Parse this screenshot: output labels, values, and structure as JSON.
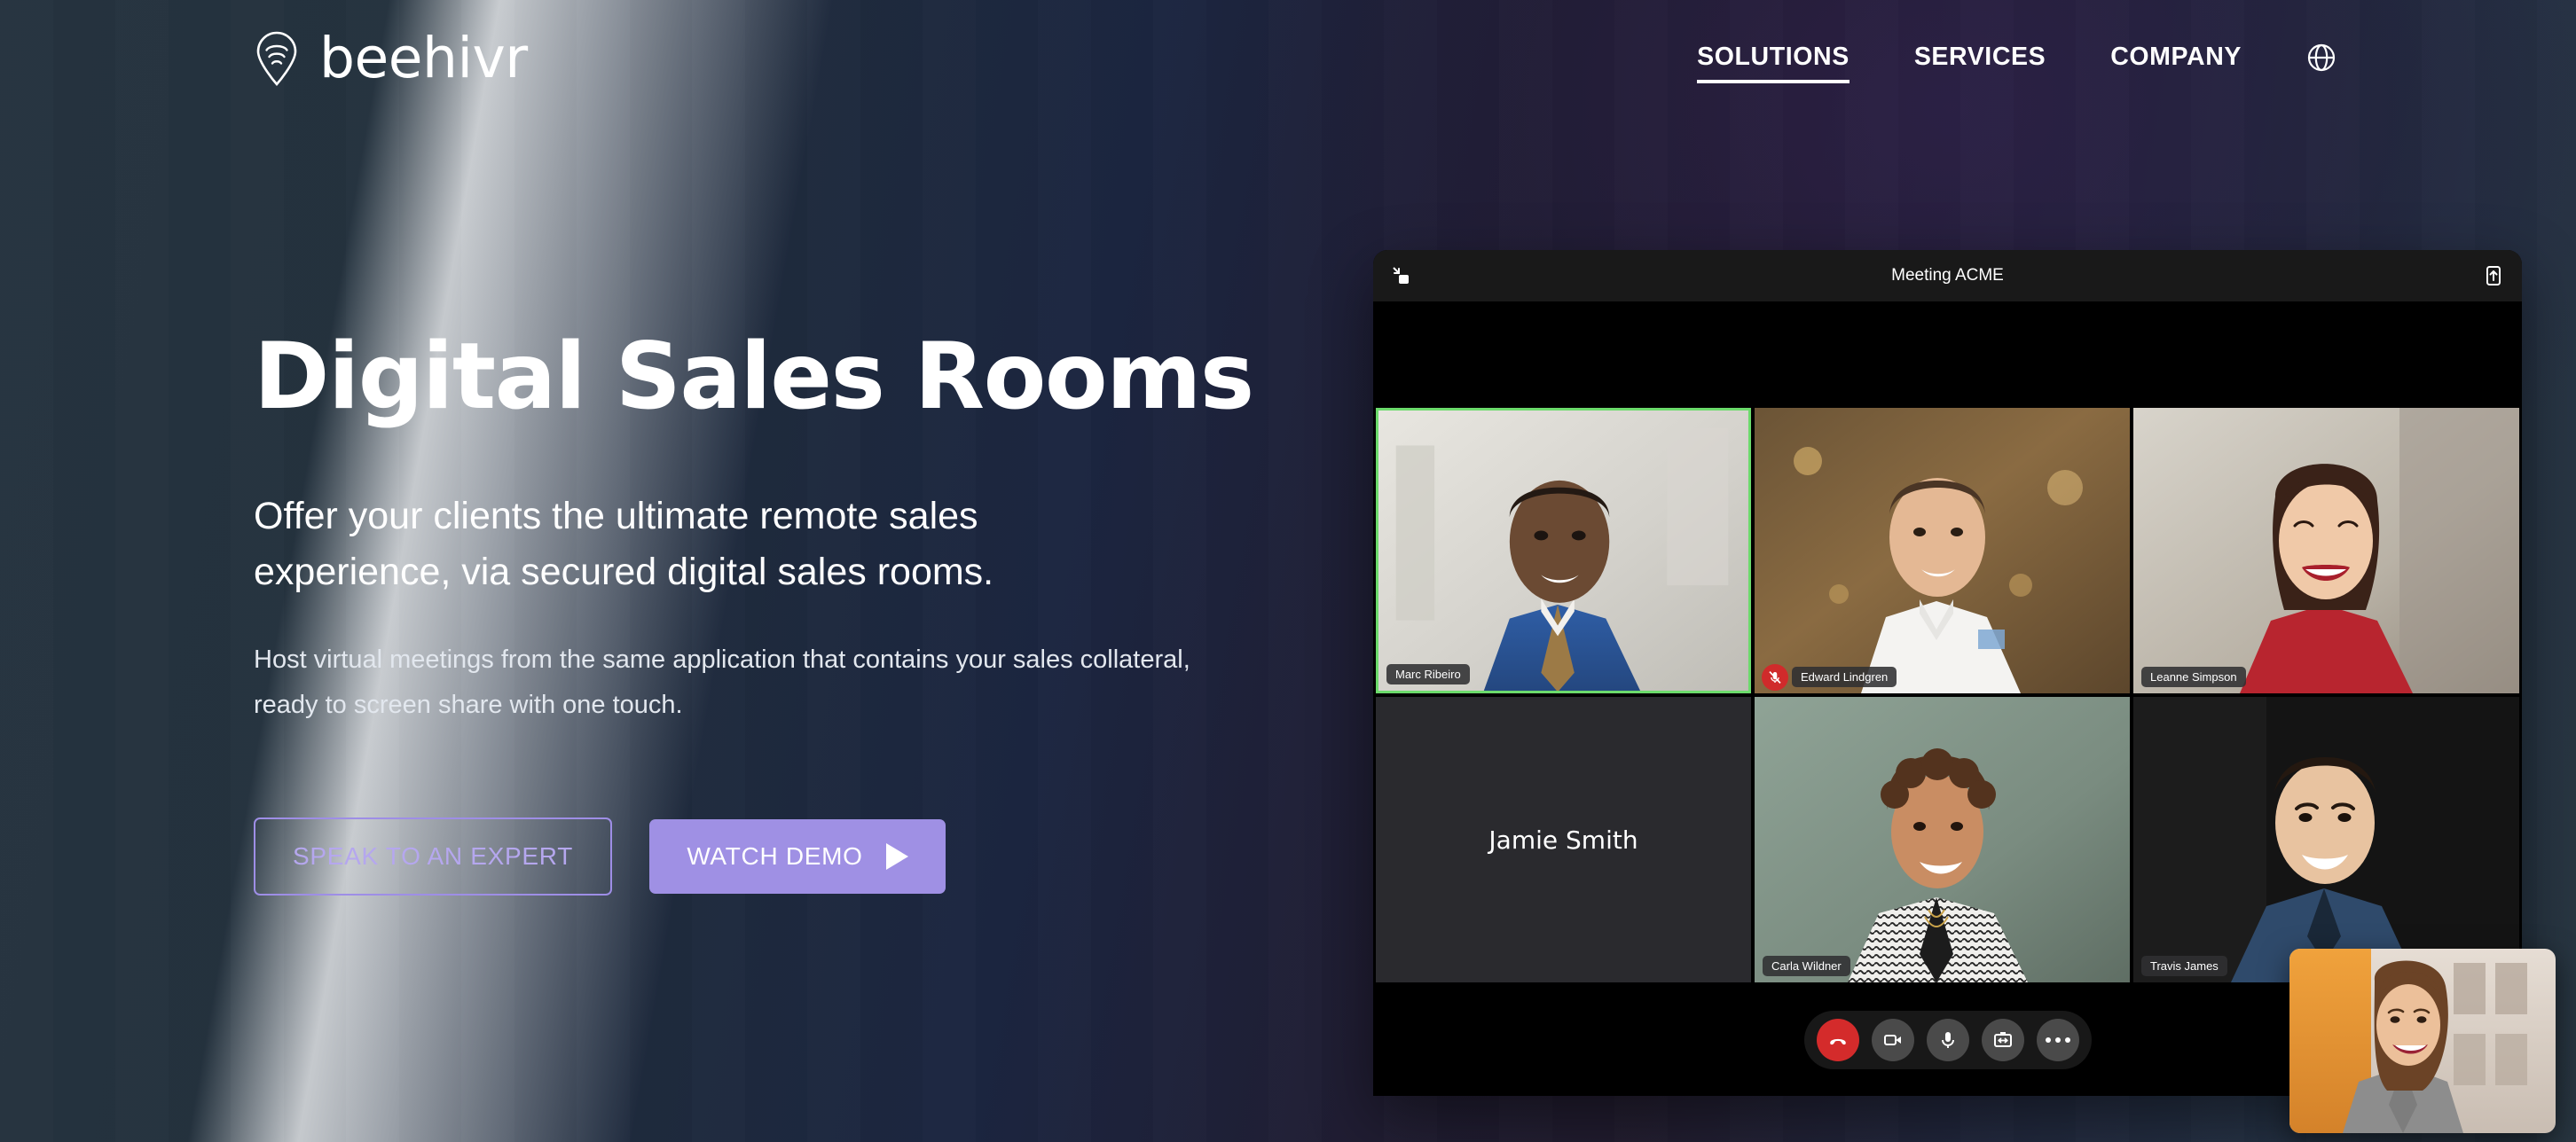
{
  "brand": {
    "name": "beehivr",
    "logo_icon": "pin-wifi-icon"
  },
  "nav": {
    "items": [
      {
        "label": "SOLUTIONS",
        "active": true
      },
      {
        "label": "SERVICES",
        "active": false
      },
      {
        "label": "COMPANY",
        "active": false
      }
    ],
    "language_icon": "globe-icon"
  },
  "hero": {
    "title": "Digital Sales Rooms",
    "subtitle": "Offer your clients the ultimate remote sales experience, via secured digital sales rooms.",
    "body": "Host virtual meetings from the same application that contains your sales collateral, ready to screen share with one touch.",
    "cta_primary": "WATCH DEMO",
    "cta_secondary": "SPEAK TO AN EXPERT"
  },
  "colors": {
    "accent_purple": "#9f90e4",
    "accent_purple_border": "#9e8ee6",
    "accent_purple_text": "#b5a7ee",
    "background_slate": "#25333f",
    "background_purple": "#211c2f",
    "speaking_border": "#6cdb6c",
    "mute_red": "#d02b2b",
    "hangup_red": "#d42b2b"
  },
  "meeting": {
    "title": "Meeting ACME",
    "titlebar_left_icon": "collapse-window-icon",
    "titlebar_right_icon": "share-screen-icon",
    "participants": [
      {
        "name": "Marc Ribeiro",
        "speaking": true,
        "muted": false,
        "camera_on": true
      },
      {
        "name": "Edward Lindgren",
        "speaking": false,
        "muted": true,
        "camera_on": true
      },
      {
        "name": "Leanne Simpson",
        "speaking": false,
        "muted": false,
        "camera_on": true
      },
      {
        "name": "Jamie Smith",
        "speaking": false,
        "muted": false,
        "camera_on": false
      },
      {
        "name": "Carla Wildner",
        "speaking": false,
        "muted": false,
        "camera_on": true
      },
      {
        "name": "Travis James",
        "speaking": false,
        "muted": false,
        "camera_on": true
      }
    ],
    "controls": [
      {
        "name": "hangup-button",
        "icon": "phone-hangup-icon"
      },
      {
        "name": "camera-button",
        "icon": "video-camera-icon"
      },
      {
        "name": "microphone-button",
        "icon": "microphone-icon"
      },
      {
        "name": "screen-share-button",
        "icon": "screen-share-icon"
      },
      {
        "name": "more-options-button",
        "icon": "more-dots-icon"
      }
    ],
    "self_view_label": "self-view"
  }
}
